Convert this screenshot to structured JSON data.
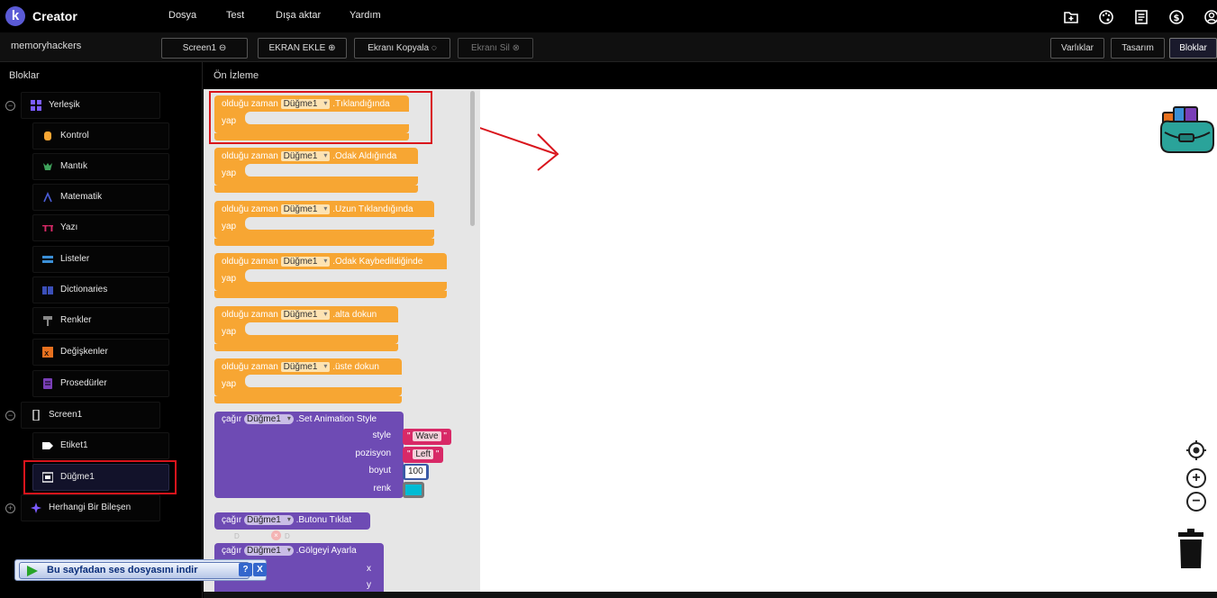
{
  "app": {
    "logo_letter": "k",
    "title": "Creator"
  },
  "menu": [
    "Dosya",
    "Test",
    "Dışa aktar",
    "Yardım"
  ],
  "top_icons": [
    "folder-add-icon",
    "palette-icon",
    "news-icon",
    "dollar-icon",
    "account-icon"
  ],
  "toolbar": {
    "project_name": "memoryhackers",
    "screen_select": "Screen1",
    "add_screen": "EKRAN EKLE",
    "copy_screen": "Ekranı Kopyala",
    "delete_screen": "Ekranı Sil",
    "assets": "Varlıklar",
    "designer": "Tasarım",
    "blocks": "Bloklar"
  },
  "sidebar": {
    "title": "Bloklar",
    "builtin": {
      "label": "Yerleşik",
      "items": [
        "Kontrol",
        "Mantık",
        "Matematik",
        "Yazı",
        "Listeler",
        "Dictionaries",
        "Renkler",
        "Değişkenler",
        "Prosedürler"
      ]
    },
    "screen": {
      "label": "Screen1",
      "items": [
        "Etiket1",
        "Düğme1"
      ]
    },
    "any_component": "Herhangi Bir Bileşen"
  },
  "preview_title": "Ön İzleme",
  "blocks": {
    "when": "olduğu zaman",
    "do": "yap",
    "call": "çağır",
    "component": "Düğme1",
    "events": [
      ".Tıklandığında",
      ".Odak Aldığında",
      ".Uzun Tıklandığında",
      ".Odak Kaybedildiğinde",
      ".alta dokun",
      ".üste dokun"
    ],
    "set_animation": ".Set Animation Style",
    "params": {
      "style": "style",
      "position": "pozisyon",
      "size": "boyut",
      "color": "renk"
    },
    "param_values": {
      "style": "Wave",
      "position": "Left",
      "size": "100",
      "quote": "\""
    },
    "click_button": ".Butonu Tıklat",
    "set_shadow": ".Gölgeyi Ayarla",
    "shadow_params": {
      "x": "x",
      "y": "y"
    },
    "faded": [
      "D",
      "D"
    ]
  },
  "audio_bar": {
    "label": "Bu sayfadan ses dosyasını indir",
    "help": "?",
    "close": "X"
  },
  "colors": {
    "event": "#f7a633",
    "procedure": "#6e4bb4",
    "highlight": "#d9141c",
    "text": "#d82967"
  }
}
